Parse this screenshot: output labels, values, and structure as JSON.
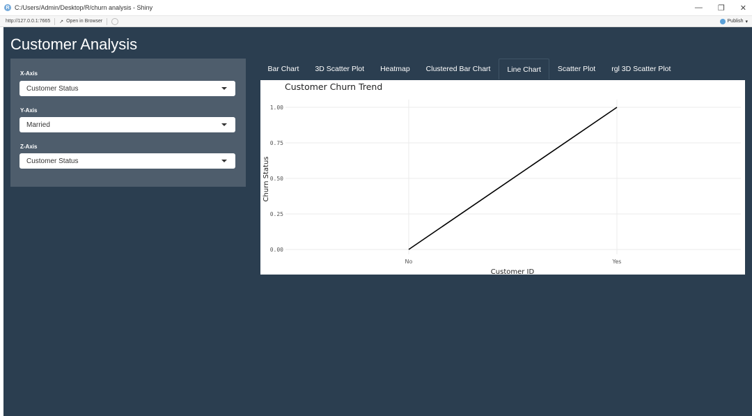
{
  "window": {
    "title": "C:/Users/Admin/Desktop/R/churn analysis - Shiny",
    "url": "http://127.0.0.1:7665",
    "open_in_browser": "Open in Browser",
    "publish": "Publish"
  },
  "app": {
    "title": "Customer Analysis"
  },
  "sidebar": {
    "x_label": "X-Axis",
    "x_value": "Customer Status",
    "y_label": "Y-Axis",
    "y_value": "Married",
    "z_label": "Z-Axis",
    "z_value": "Customer Status"
  },
  "tabs": [
    {
      "label": "Bar Chart"
    },
    {
      "label": "3D Scatter Plot"
    },
    {
      "label": "Heatmap"
    },
    {
      "label": "Clustered Bar Chart"
    },
    {
      "label": "Line Chart",
      "active": true
    },
    {
      "label": "Scatter Plot"
    },
    {
      "label": "rgl 3D Scatter Plot"
    }
  ],
  "colors": {
    "app_bg": "#2b3e50",
    "sidebar_bg": "#4e5d6c",
    "line": "#000000",
    "grid": "#ebebeb"
  },
  "chart_data": {
    "type": "line",
    "title": "Customer Churn Trend",
    "xlabel": "Customer ID",
    "ylabel": "Churn Status",
    "categories": [
      "No",
      "Yes"
    ],
    "values": [
      0,
      1
    ],
    "ylim": [
      0,
      1
    ],
    "y_ticks": [
      "0.00",
      "0.25",
      "0.50",
      "0.75",
      "1.00"
    ],
    "grid": true,
    "legend": "none"
  }
}
